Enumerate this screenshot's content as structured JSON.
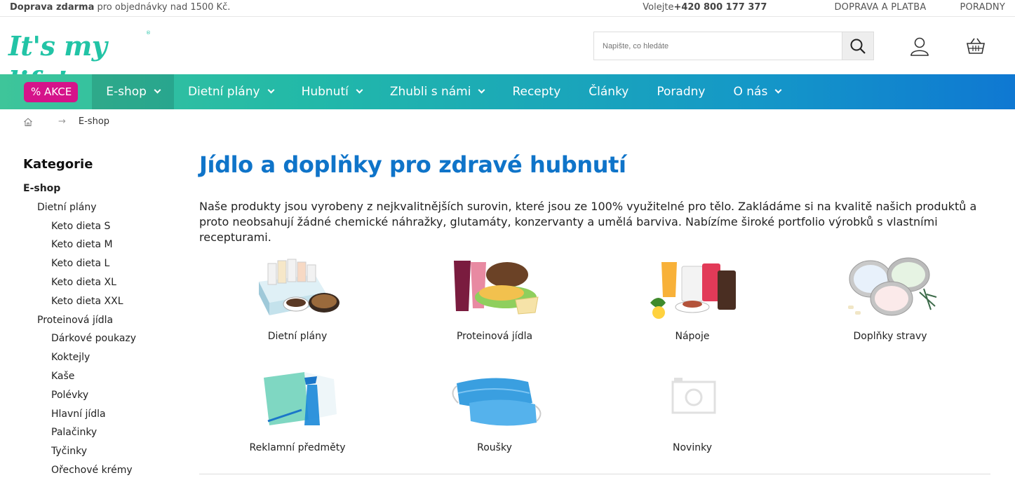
{
  "topbar": {
    "promo_bold": "Doprava zdarma",
    "promo_rest": " pro objednávky nad 1500 Kč.",
    "phone_prefix": "Volejte ",
    "phone_number": "+420 800 177 377",
    "links": [
      "DOPRAVA A PLATBA",
      "PORADNY"
    ]
  },
  "header": {
    "logo_text": "It's my life!",
    "logo_reg": "®",
    "search_placeholder": "Napište, co hledáte"
  },
  "nav": {
    "akce": "% AKCE",
    "items": [
      "E-shop",
      "Dietní plány",
      "Hubnutí",
      "Zhubli s námi",
      "Recepty",
      "Články",
      "Poradny",
      "O nás"
    ]
  },
  "breadcrumb": {
    "arrow": "→",
    "current": "E-shop"
  },
  "sidebar": {
    "title": "Kategorie",
    "items": [
      {
        "label": "E-shop",
        "level": 0
      },
      {
        "label": "Dietní plány",
        "level": 1
      },
      {
        "label": "Keto dieta S",
        "level": 2
      },
      {
        "label": "Keto dieta M",
        "level": 2
      },
      {
        "label": "Keto dieta L",
        "level": 2
      },
      {
        "label": "Keto dieta XL",
        "level": 2
      },
      {
        "label": "Keto dieta XXL",
        "level": 2
      },
      {
        "label": "Proteinová jídla",
        "level": 1
      },
      {
        "label": "Dárkové poukazy",
        "level": 2
      },
      {
        "label": "Koktejly",
        "level": 2
      },
      {
        "label": "Kaše",
        "level": 2
      },
      {
        "label": "Polévky",
        "level": 2
      },
      {
        "label": "Hlavní jídla",
        "level": 2
      },
      {
        "label": "Palačinky",
        "level": 2
      },
      {
        "label": "Tyčinky",
        "level": 2
      },
      {
        "label": "Ořechové krémy",
        "level": 2
      }
    ]
  },
  "main": {
    "title": "Jídlo a doplňky pro zdravé hubnutí",
    "intro": "Naše produkty jsou vyrobeny z nejkvalitnějších surovin, které jsou ze 100% využitelné pro tělo. Zakládáme si na kvalitě našich produktů a proto neobsahují žádné chemické náhražky, glutamáty, konzervanty a umělá barviva. Nabízíme široké portfolio výrobků s vlastními recepturami.",
    "categories": [
      {
        "label": "Dietní plány",
        "icon": "diet-plan-box-image"
      },
      {
        "label": "Proteinová jídla",
        "icon": "protein-food-image"
      },
      {
        "label": "Nápoje",
        "icon": "drinks-image"
      },
      {
        "label": "Doplňky stravy",
        "icon": "supplements-tins-image"
      },
      {
        "label": "Reklamní předměty",
        "icon": "promo-items-image"
      },
      {
        "label": "Roušky",
        "icon": "face-masks-image"
      },
      {
        "label": "Novinky",
        "icon": "camera-placeholder-icon"
      }
    ]
  }
}
